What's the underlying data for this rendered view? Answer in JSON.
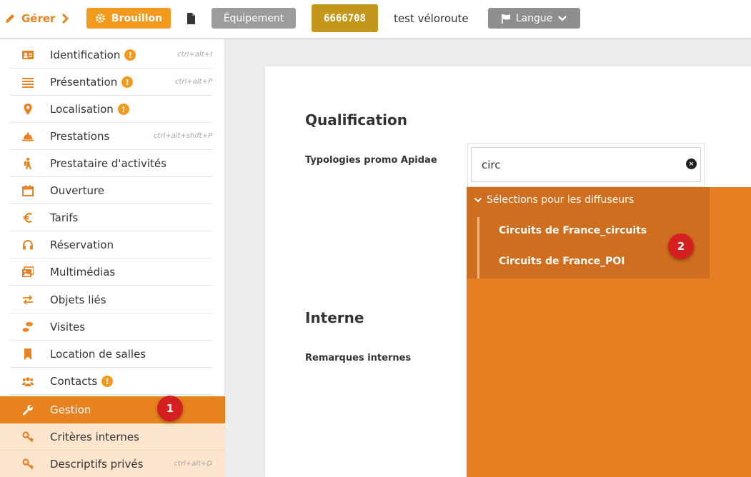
{
  "topbar": {
    "gerer_label": "Gérer",
    "status_label": "Brouillon",
    "type_label": "Équipement",
    "object_id": "6666708",
    "object_name": "test véloroute",
    "language_label": "Langue"
  },
  "sidebar": {
    "items": [
      {
        "label": "Identification",
        "shortcut": "ctrl+alt+I",
        "warning": "!"
      },
      {
        "label": "Présentation",
        "shortcut": "ctrl+alt+P",
        "warning": "!"
      },
      {
        "label": "Localisation",
        "shortcut": "",
        "warning": "!"
      },
      {
        "label": "Prestations",
        "shortcut": "ctrl+alt+shift+P",
        "warning": ""
      },
      {
        "label": "Prestataire d'activités",
        "shortcut": "",
        "warning": ""
      },
      {
        "label": "Ouverture",
        "shortcut": "",
        "warning": ""
      },
      {
        "label": "Tarifs",
        "shortcut": "",
        "warning": ""
      },
      {
        "label": "Réservation",
        "shortcut": "",
        "warning": ""
      },
      {
        "label": "Multimédias",
        "shortcut": "",
        "warning": ""
      },
      {
        "label": "Objets liés",
        "shortcut": "",
        "warning": ""
      },
      {
        "label": "Visites",
        "shortcut": "",
        "warning": ""
      },
      {
        "label": "Location de salles",
        "shortcut": "",
        "warning": ""
      },
      {
        "label": "Contacts",
        "shortcut": "",
        "warning": "!"
      },
      {
        "label": "Gestion",
        "shortcut": "",
        "warning": ""
      },
      {
        "label": "Critères internes",
        "shortcut": "",
        "warning": ""
      },
      {
        "label": "Descriptifs privés",
        "shortcut": "ctrl+alt+D",
        "warning": ""
      }
    ]
  },
  "content": {
    "qualification_title": "Qualification",
    "typologies_label": "Typologies promo Apidae",
    "search_value": "circ",
    "clear_symbol": "×",
    "interne_title": "Interne",
    "remarques_label": "Remarques internes"
  },
  "dropdown": {
    "group_label": "Sélections pour les diffuseurs",
    "options": [
      "Circuits de France_circuits",
      "Circuits de France_POI"
    ]
  },
  "markers": {
    "m1": "1",
    "m2": "2"
  },
  "colors": {
    "accent": "#e8821f",
    "status": "#f19a1b",
    "id_badge": "#c4961b",
    "marker": "#d42020",
    "dropdown": "#e67e22",
    "submenu": "#fbe5cd"
  }
}
